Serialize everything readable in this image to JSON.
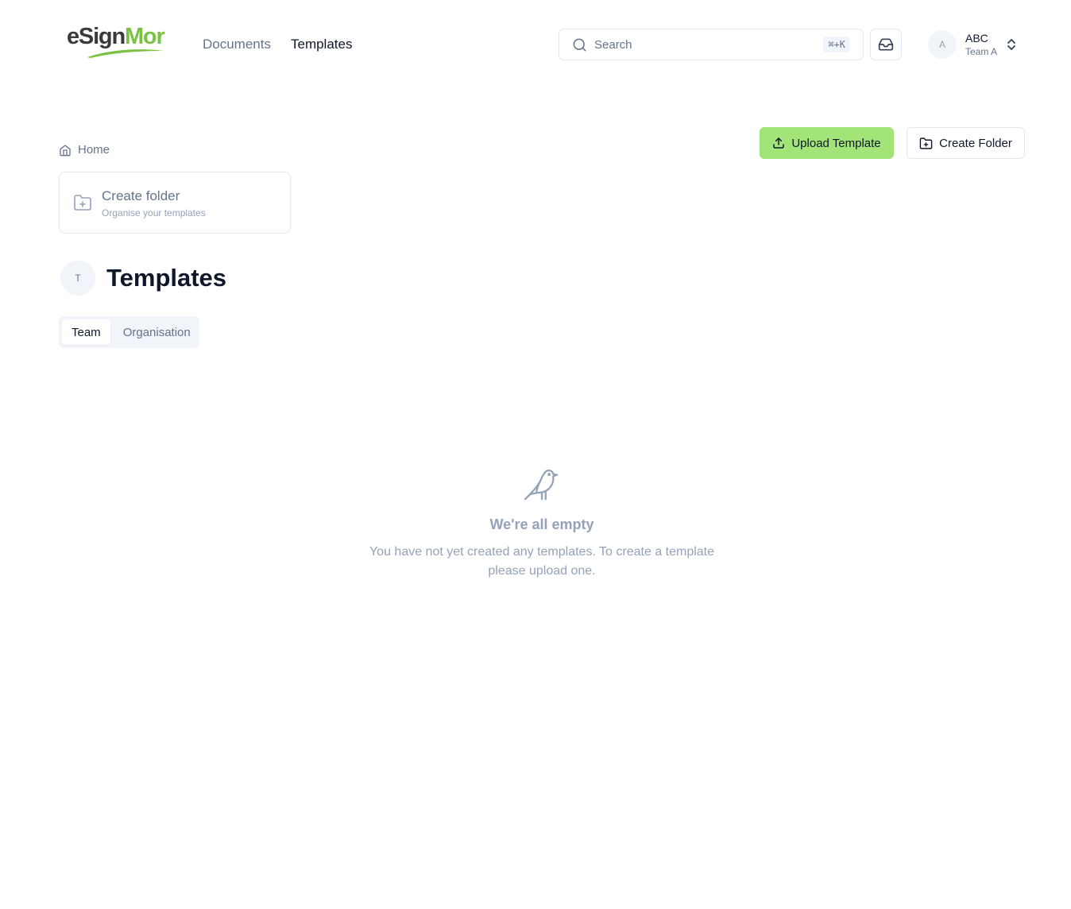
{
  "header": {
    "logo": {
      "part1": "eS",
      "part2": "ign",
      "part3": "Mor"
    },
    "nav": [
      {
        "label": "Documents",
        "active": false
      },
      {
        "label": "Templates",
        "active": true
      }
    ],
    "search": {
      "placeholder": "Search",
      "shortcut": "⌘+K"
    },
    "account": {
      "avatar_initial": "A",
      "name": "ABC",
      "team": "Team A"
    }
  },
  "actions": {
    "upload_label": "Upload Template",
    "create_folder_label": "Create Folder"
  },
  "breadcrumb": {
    "home_label": "Home"
  },
  "folder_card": {
    "title": "Create folder",
    "subtitle": "Organise your templates"
  },
  "page": {
    "avatar_initial": "T",
    "title": "Templates"
  },
  "tabs": [
    {
      "label": "Team",
      "active": true
    },
    {
      "label": "Organisation",
      "active": false
    }
  ],
  "empty_state": {
    "title": "We're all empty",
    "description": "You have not yet created any templates. To create a template please upload one."
  },
  "colors": {
    "accent": "#a3e479",
    "brand_green": "#7bc142",
    "muted": "#64748b"
  }
}
